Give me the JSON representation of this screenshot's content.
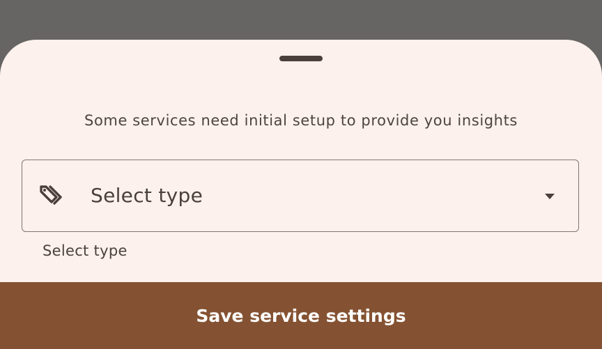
{
  "sheet": {
    "subtitle": "Some services need initial setup to provide you insights",
    "select_field": {
      "value": "Select type",
      "leading_icon": "tag-icon",
      "trailing_icon": "dropdown-arrow-icon",
      "helper_text": "Select type"
    },
    "save_button_label": "Save service settings"
  },
  "colors": {
    "scrim": "#676564",
    "sheet_background": "#fcf1ec",
    "button_background": "#845232",
    "button_text": "#ffffff",
    "text_primary": "#4a3f3b",
    "outline": "#84746d"
  }
}
